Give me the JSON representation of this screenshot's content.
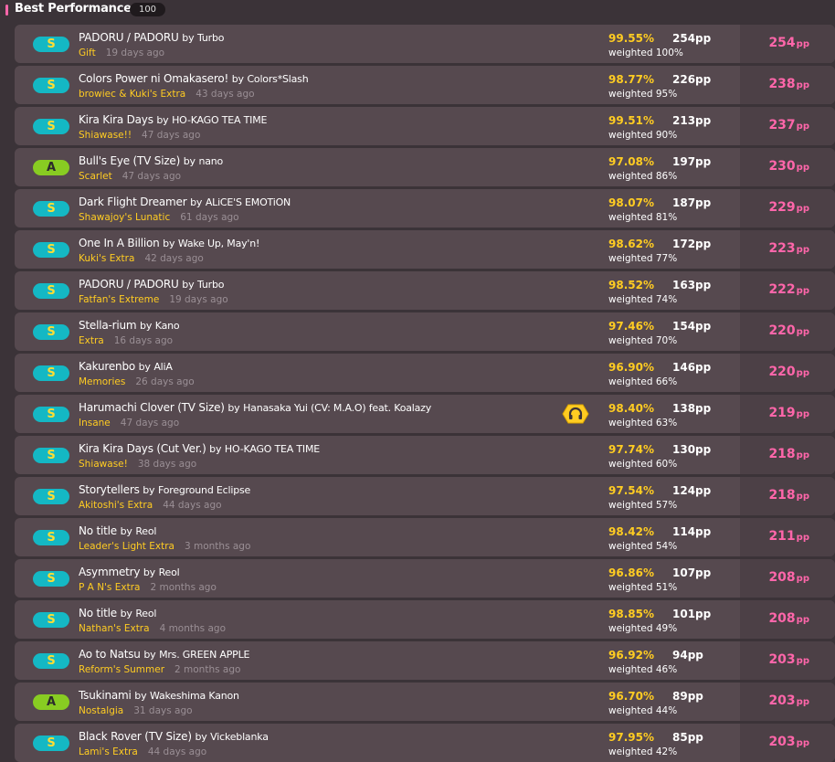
{
  "header": {
    "title": "Best Performance",
    "count": "100"
  },
  "colors": {
    "accent": "#ff66aa",
    "accuracy": "#ffcc22",
    "grade_S": "#14b8c4",
    "grade_A": "#88cc22"
  },
  "scores": [
    {
      "grade": "S",
      "title": "PADORU / PADORU",
      "by": "by",
      "artist": "Turbo",
      "difficulty": "Gift",
      "date": "19 days ago",
      "accuracy": "99.55%",
      "pp": "254pp",
      "weighted": "weighted 100%",
      "raw_pp": "254",
      "raw_unit": "pp"
    },
    {
      "grade": "S",
      "title": "Colors Power ni Omakasero!",
      "by": "by",
      "artist": "Colors*Slash",
      "difficulty": "browiec & Kuki's Extra",
      "date": "43 days ago",
      "accuracy": "98.77%",
      "pp": "226pp",
      "weighted": "weighted 95%",
      "raw_pp": "238",
      "raw_unit": "pp"
    },
    {
      "grade": "S",
      "title": "Kira Kira Days",
      "by": "by",
      "artist": "HO-KAGO TEA TIME",
      "difficulty": "Shiawase!!",
      "date": "47 days ago",
      "accuracy": "99.51%",
      "pp": "213pp",
      "weighted": "weighted 90%",
      "raw_pp": "237",
      "raw_unit": "pp"
    },
    {
      "grade": "A",
      "title": "Bull's Eye (TV Size)",
      "by": "by",
      "artist": "nano",
      "difficulty": "Scarlet",
      "date": "47 days ago",
      "accuracy": "97.08%",
      "pp": "197pp",
      "weighted": "weighted 86%",
      "raw_pp": "230",
      "raw_unit": "pp"
    },
    {
      "grade": "S",
      "title": "Dark Flight Dreamer",
      "by": "by",
      "artist": "ALiCE'S EMOTiON",
      "difficulty": "Shawajoy's Lunatic",
      "date": "61 days ago",
      "accuracy": "98.07%",
      "pp": "187pp",
      "weighted": "weighted 81%",
      "raw_pp": "229",
      "raw_unit": "pp"
    },
    {
      "grade": "S",
      "title": "One In A Billion",
      "by": "by",
      "artist": "Wake Up, May'n!",
      "difficulty": "Kuki's Extra",
      "date": "42 days ago",
      "accuracy": "98.62%",
      "pp": "172pp",
      "weighted": "weighted 77%",
      "raw_pp": "223",
      "raw_unit": "pp"
    },
    {
      "grade": "S",
      "title": "PADORU / PADORU",
      "by": "by",
      "artist": "Turbo",
      "difficulty": "Fatfan's Extreme",
      "date": "19 days ago",
      "accuracy": "98.52%",
      "pp": "163pp",
      "weighted": "weighted 74%",
      "raw_pp": "222",
      "raw_unit": "pp"
    },
    {
      "grade": "S",
      "title": "Stella-rium",
      "by": "by",
      "artist": "Kano",
      "difficulty": "Extra",
      "date": "16 days ago",
      "accuracy": "97.46%",
      "pp": "154pp",
      "weighted": "weighted 70%",
      "raw_pp": "220",
      "raw_unit": "pp"
    },
    {
      "grade": "S",
      "title": "Kakurenbo",
      "by": "by",
      "artist": "AliA",
      "difficulty": "Memories",
      "date": "26 days ago",
      "accuracy": "96.90%",
      "pp": "146pp",
      "weighted": "weighted 66%",
      "raw_pp": "220",
      "raw_unit": "pp"
    },
    {
      "grade": "S",
      "title": "Harumachi Clover (TV Size)",
      "by": "by",
      "artist": "Hanasaka Yui (CV: M.A.O) feat. Koalazy",
      "difficulty": "Insane",
      "date": "47 days ago",
      "accuracy": "98.40%",
      "pp": "138pp",
      "weighted": "weighted 63%",
      "raw_pp": "219",
      "raw_unit": "pp",
      "mod": "headphones-mod-icon"
    },
    {
      "grade": "S",
      "title": "Kira Kira Days (Cut Ver.)",
      "by": "by",
      "artist": "HO-KAGO TEA TIME",
      "difficulty": "Shiawase!",
      "date": "38 days ago",
      "accuracy": "97.74%",
      "pp": "130pp",
      "weighted": "weighted 60%",
      "raw_pp": "218",
      "raw_unit": "pp"
    },
    {
      "grade": "S",
      "title": "Storytellers",
      "by": "by",
      "artist": "Foreground Eclipse",
      "difficulty": "Akitoshi's Extra",
      "date": "44 days ago",
      "accuracy": "97.54%",
      "pp": "124pp",
      "weighted": "weighted 57%",
      "raw_pp": "218",
      "raw_unit": "pp"
    },
    {
      "grade": "S",
      "title": "No title",
      "by": "by",
      "artist": "Reol",
      "difficulty": "Leader's Light Extra",
      "date": "3 months ago",
      "accuracy": "98.42%",
      "pp": "114pp",
      "weighted": "weighted 54%",
      "raw_pp": "211",
      "raw_unit": "pp"
    },
    {
      "grade": "S",
      "title": "Asymmetry",
      "by": "by",
      "artist": "Reol",
      "difficulty": "P A N's Extra",
      "date": "2 months ago",
      "accuracy": "96.86%",
      "pp": "107pp",
      "weighted": "weighted 51%",
      "raw_pp": "208",
      "raw_unit": "pp"
    },
    {
      "grade": "S",
      "title": "No title",
      "by": "by",
      "artist": "Reol",
      "difficulty": "Nathan's Extra",
      "date": "4 months ago",
      "accuracy": "98.85%",
      "pp": "101pp",
      "weighted": "weighted 49%",
      "raw_pp": "208",
      "raw_unit": "pp"
    },
    {
      "grade": "S",
      "title": "Ao to Natsu",
      "by": "by",
      "artist": "Mrs. GREEN APPLE",
      "difficulty": "Reform's Summer",
      "date": "2 months ago",
      "accuracy": "96.92%",
      "pp": "94pp",
      "weighted": "weighted 46%",
      "raw_pp": "203",
      "raw_unit": "pp"
    },
    {
      "grade": "A",
      "title": "Tsukinami",
      "by": "by",
      "artist": "Wakeshima Kanon",
      "difficulty": "Nostalgia",
      "date": "31 days ago",
      "accuracy": "96.70%",
      "pp": "89pp",
      "weighted": "weighted 44%",
      "raw_pp": "203",
      "raw_unit": "pp"
    },
    {
      "grade": "S",
      "title": "Black Rover (TV Size)",
      "by": "by",
      "artist": "Vickeblanka",
      "difficulty": "Lami's Extra",
      "date": "44 days ago",
      "accuracy": "97.95%",
      "pp": "85pp",
      "weighted": "weighted 42%",
      "raw_pp": "203",
      "raw_unit": "pp"
    }
  ]
}
